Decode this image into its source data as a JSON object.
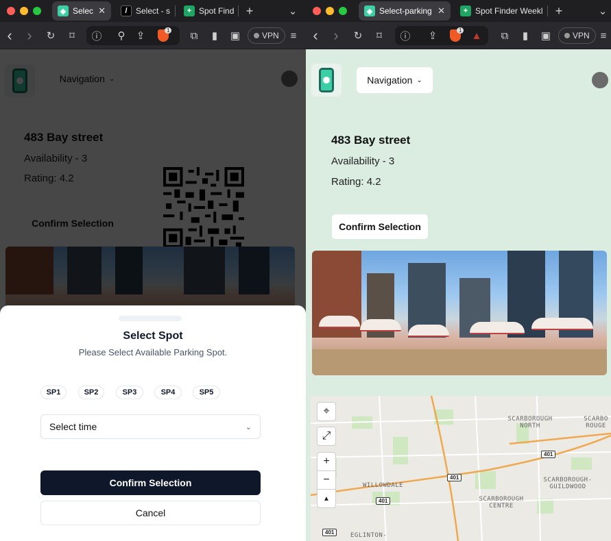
{
  "left_browser": {
    "tabs": [
      {
        "title": "Selec",
        "active": true,
        "close": "✕"
      },
      {
        "title": "Select - s",
        "active": false
      },
      {
        "title": "Spot Find",
        "active": false
      }
    ],
    "new_tab": "+",
    "menu": "⌄"
  },
  "right_browser": {
    "tabs": [
      {
        "title": "Select-parking",
        "active": true,
        "close": "✕"
      },
      {
        "title": "Spot Finder Weekl",
        "active": false
      }
    ],
    "new_tab": "+",
    "menu": "⌄"
  },
  "toolbar": {
    "back": "‹",
    "forward": "›",
    "reload": "↻",
    "bookmark": "⌑",
    "info": "ⓘ",
    "location": "⚲",
    "share": "⇪",
    "shield_badge": "1",
    "extensions": "⧉",
    "sidebar": "▮",
    "wallet": "▣",
    "vpn_label": "VPN",
    "menu": "≡"
  },
  "app": {
    "nav_label": "Navigation",
    "nav_chevron": "⌄",
    "address": "483 Bay street",
    "availability": "Availability - 3",
    "rating": "Rating: 4.2",
    "confirm_label": "Confirm Selection"
  },
  "modal": {
    "title": "Select Spot",
    "subtitle": "Please Select Available Parking Spot.",
    "spots": [
      "SP1",
      "SP2",
      "SP3",
      "SP4",
      "SP5"
    ],
    "time_placeholder": "Select time",
    "confirm_label": "Confirm Selection",
    "cancel_label": "Cancel"
  },
  "map": {
    "controls": {
      "locate": "⌖",
      "fullscreen": "⤢",
      "zoom_in": "+",
      "zoom_out": "−",
      "north": "▲"
    },
    "labels": [
      "SCARBOROUGH NORTH",
      "SCARBO ROUGE",
      "SCARBOROUGH-GUILDWOOD",
      "WILLOWDALE",
      "SCARBOROUGH CENTRE",
      "EGLINTON-"
    ],
    "route_shield": "401"
  },
  "colors": {
    "app_bg": "#dbece0",
    "primary_dark": "#0f172a",
    "tab_bar": "#1f1f22",
    "toolbar": "#2a2a2e"
  }
}
